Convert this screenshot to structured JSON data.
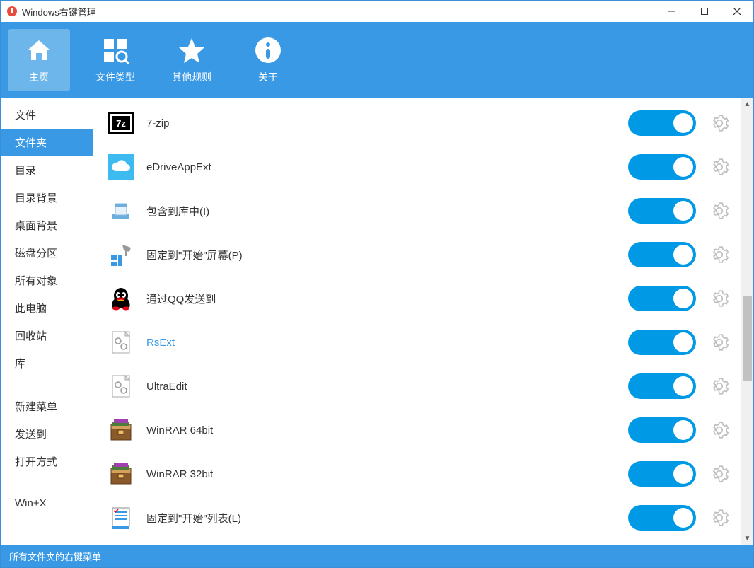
{
  "window": {
    "title": "Windows右键管理"
  },
  "toolbar": {
    "home": "主页",
    "filetype": "文件类型",
    "other": "其他规则",
    "about": "关于"
  },
  "sidebar": {
    "items": [
      "文件",
      "文件夹",
      "目录",
      "目录背景",
      "桌面背景",
      "磁盘分区",
      "所有对象",
      "此电脑",
      "回收站",
      "库"
    ],
    "group2": [
      "新建菜单",
      "发送到",
      "打开方式"
    ],
    "group3": [
      "Win+X"
    ],
    "selected": "文件夹"
  },
  "list": [
    {
      "label": "7-zip",
      "on": true,
      "icon": "7z"
    },
    {
      "label": "eDriveAppExt",
      "on": true,
      "icon": "cloud"
    },
    {
      "label": "包含到库中(I)",
      "on": true,
      "icon": "library"
    },
    {
      "label": "固定到\"开始\"屏幕(P)",
      "on": true,
      "icon": "pin-start"
    },
    {
      "label": "通过QQ发送到",
      "on": true,
      "icon": "qq"
    },
    {
      "label": "RsExt",
      "on": true,
      "icon": "gears-doc",
      "blue": true
    },
    {
      "label": "UltraEdit",
      "on": true,
      "icon": "gears-doc"
    },
    {
      "label": "WinRAR 64bit",
      "on": true,
      "icon": "winrar"
    },
    {
      "label": "WinRAR 32bit",
      "on": true,
      "icon": "winrar"
    },
    {
      "label": "固定到\"开始\"列表(L)",
      "on": true,
      "icon": "pin-list"
    }
  ],
  "status": "所有文件夹的右键菜单"
}
